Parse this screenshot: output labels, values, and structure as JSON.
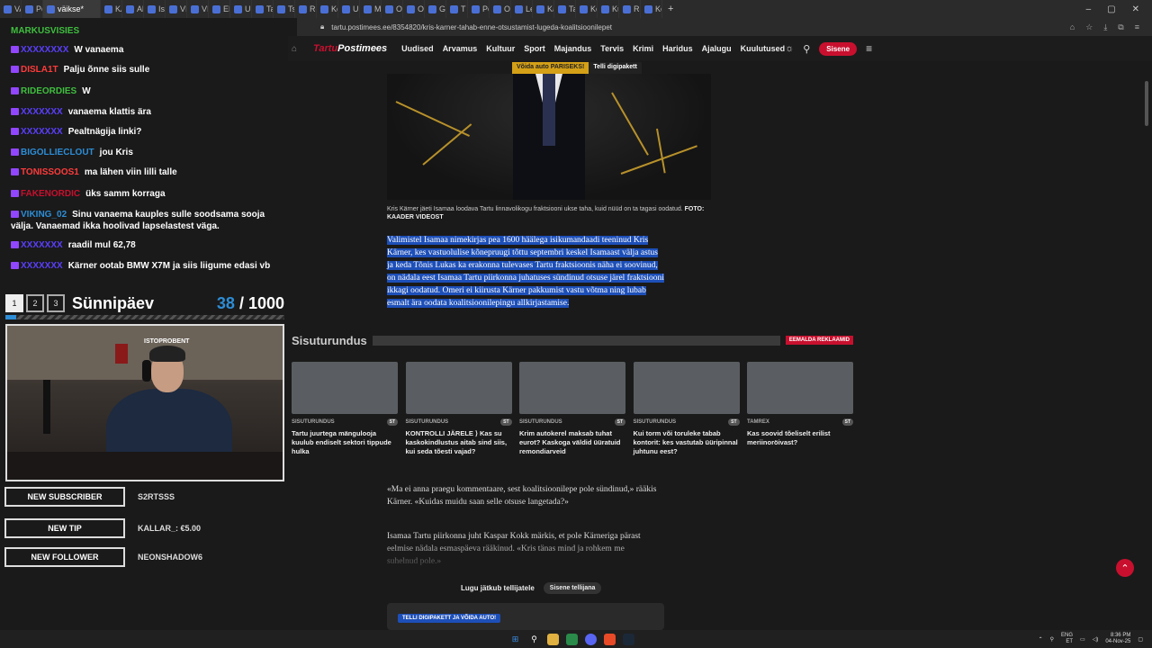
{
  "browser": {
    "tabs": [
      {
        "label": "VAIDEO",
        "active": false
      },
      {
        "label": "Postimees",
        "active": false
      },
      {
        "label": "väikse*",
        "active": true
      },
      {
        "label": "KARI",
        "active": false
      },
      {
        "label": "Alaes",
        "active": false
      },
      {
        "label": "Isam",
        "active": false
      },
      {
        "label": "VIDE",
        "active": false
      },
      {
        "label": "VIDE",
        "active": false
      },
      {
        "label": "EKRI",
        "active": false
      },
      {
        "label": "Uuel",
        "active": false
      },
      {
        "label": "Tali v",
        "active": false
      },
      {
        "label": "Tsahi",
        "active": false
      },
      {
        "label": "Reim",
        "active": false
      },
      {
        "label": "Kohu",
        "active": false
      },
      {
        "label": "Uute",
        "active": false
      },
      {
        "label": "Marti",
        "active": false
      },
      {
        "label": "Ossi",
        "active": false
      },
      {
        "label": "Olds",
        "active": false
      },
      {
        "label": "Geen",
        "active": false
      },
      {
        "label": "T gru",
        "active": false
      },
      {
        "label": "Pevk",
        "active": false
      },
      {
        "label": "Olds",
        "active": false
      },
      {
        "label": "Leedi",
        "active": false
      },
      {
        "label": "Kaid",
        "active": false
      },
      {
        "label": "Tartu",
        "active": false
      },
      {
        "label": "Kohu",
        "active": false
      },
      {
        "label": "Kui p",
        "active": false
      },
      {
        "label": "Regi",
        "active": false
      },
      {
        "label": "Kom",
        "active": false
      }
    ],
    "new_tab": "+",
    "url": "tartu.postimees.ee/8354820/kris-karner-tahab-enne-otsustamist-lugeda-koalitsioonilepet"
  },
  "site": {
    "logo_left": "Tartu",
    "logo_right": "Postimees",
    "nav": [
      "Uudised",
      "Arvamus",
      "Kultuur",
      "Sport",
      "Majandus",
      "Tervis",
      "Krimi",
      "Haridus",
      "Ajalugu",
      "Kuulutused"
    ],
    "signin": "Sisene",
    "promo_1": "Võida auto PARISEKS!",
    "promo_2": "Telli digipakett"
  },
  "chat": {
    "header": "MARKUSVISIES",
    "messages": [
      {
        "user": "XXXXXXXX",
        "color": "#5a3fff",
        "text": "W vanaema"
      },
      {
        "user": "DISLA1T",
        "color": "#ff3b3b",
        "text": "Palju õnne siis sulle"
      },
      {
        "user": "RIDEORDIES",
        "color": "#3fbf3f",
        "text": "W"
      },
      {
        "user": "XXXXXXX",
        "color": "#5a3fff",
        "text": "vanaema klattis ära"
      },
      {
        "user": "XXXXXXX",
        "color": "#5a3fff",
        "text": "Pealtnägija linki?"
      },
      {
        "user": "BIGOLLIECLOUT",
        "color": "#2d8dd6",
        "text": "jou Kris"
      },
      {
        "user": "TONISSOOS1",
        "color": "#ff3b3b",
        "text": "ma lähen viin lilli talle"
      },
      {
        "user": "FAKENORDIC",
        "color": "#c8102e",
        "text": "üks samm korraga"
      },
      {
        "user": "VIKING_02",
        "color": "#2d8dd6",
        "text": "Sinu vanaema kauples sulle soodsama sooja välja. Vanaemad ikka hoolivad lapselastest väga."
      },
      {
        "user": "XXXXXXX",
        "color": "#5a3fff",
        "text": "raadil mul 62,78"
      },
      {
        "user": "XXXXXXX",
        "color": "#5a3fff",
        "text": "Kärner ootab BMW X7M ja siis liigume edasi vb"
      }
    ]
  },
  "goal": {
    "boxes": [
      "1",
      "2",
      "3"
    ],
    "title": "Sünnipäev",
    "current": "38",
    "separator": " / ",
    "target": "1000",
    "progress": 0.038
  },
  "cam": {
    "tag": "ISTOPROBENT"
  },
  "alerts": [
    {
      "label": "NEW SUBSCRIBER",
      "value": "S2RTSSS"
    },
    {
      "label": "NEW TIP",
      "value": "KALLAR_: €5.00"
    },
    {
      "label": "NEW FOLLOWER",
      "value": "NEONSHADOW6"
    }
  ],
  "article": {
    "caption": "Kris Kärner jäeti Isamaa loodava Tartu linnavolikogu fraktsiooni ukse taha, kuid nüüd on ta tagasi oodatud.",
    "credit": "FOTO: KAADER VIDEOST",
    "lead": "Valimistel Isamaa nimekirjas pea 1600 häälega isikumandaadi teeninud Kris Kärner, kes vastuolulise kõnepruugi tõttu septembri keskel Isamaast välja astus ja keda Tõnis Lukas ka erakonna tulevases Tartu fraktsioonis näha ei soovinud, on nädala eest Isamaa Tartu piirkonna juhatuses sündinud otsuse järel fraktsiooni ikkagi oodatud. Omeri ei kiirusta Kärner pakkumist vastu võtma ning lubab esmalt ära oodata koalitsioonilepingu allkirjastamise.",
    "quote": "«Ma ei anna praegu kommentaare, sest koalitsioonilepe pole sündinud,» rääkis Kärner. «Kuidas muidu saan selle otsuse langetada?»",
    "para2": "Isamaa Tartu piirkonna juht Kaspar Kokk märkis, et pole Kärneriga pärast eelmise nädala esmaspäeva rääkinud. «Kris tänas mind ja rohkem me suhelnud pole.»",
    "paywall_text": "Lugu jätkub tellijatele",
    "paywall_button": "Sisene tellijana",
    "sub_badge": "TELLI DIGIPAKETT JA VÕIDA AUTO!"
  },
  "sponsored": {
    "title": "Sisuturundus",
    "remove": "EEMALDA REKLAAMID",
    "cards": [
      {
        "source": "SISUTURUNDUS",
        "badge": "ST",
        "title": "Tartu juurtega mängulooja kuulub endiselt sektori tippude hulka"
      },
      {
        "source": "SISUTURUNDUS",
        "badge": "ST",
        "title": "KONTROLLI JÄRELE ⟩ Kas su kaskokindlustus aitab sind siis, kui seda tõesti vajad?"
      },
      {
        "source": "SISUTURUNDUS",
        "badge": "ST",
        "title": "Krim autokerel maksab tuhat eurot? Kaskoga väldid üüratuid remondiarveid"
      },
      {
        "source": "SISUTURUNDUS",
        "badge": "ST",
        "title": "Kui torm või toruleke tabab kontorit: kes vastutab üüripinnal juhtunu eest?"
      },
      {
        "source": "TAMREX",
        "badge": "ST",
        "title": "Kas soovid tõeliselt erilist meriinoröivast?"
      }
    ]
  },
  "taskbar": {
    "lang_top": "ENG",
    "lang_bottom": "ET",
    "time": "8:36 PM",
    "date": "04-Nov-25"
  },
  "colors": {
    "accent": "#c8102e",
    "highlight": "#1d4fb8",
    "goal_blue": "#2d8dd6"
  }
}
